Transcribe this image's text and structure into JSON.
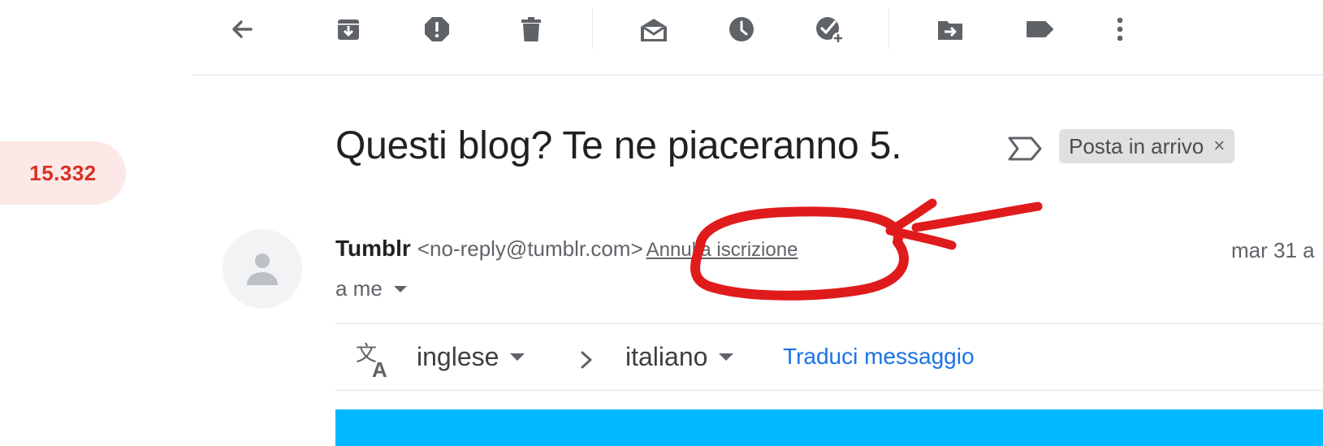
{
  "toolbar": {
    "buttons": [
      {
        "icon": "back-arrow-icon"
      },
      {
        "icon": "archive-icon"
      },
      {
        "icon": "report-spam-icon"
      },
      {
        "icon": "delete-icon"
      },
      {
        "icon": "mark-unread-icon"
      },
      {
        "icon": "snooze-icon"
      },
      {
        "icon": "add-to-tasks-icon"
      },
      {
        "icon": "move-to-icon"
      },
      {
        "icon": "label-icon"
      },
      {
        "icon": "more-vert-icon"
      }
    ]
  },
  "sidebar": {
    "inbox_count": "15.332"
  },
  "email": {
    "subject": "Questi blog? Te ne piaceranno 5.",
    "label_chip": "Posta in arrivo",
    "label_chip_close": "×",
    "sender_name": "Tumblr",
    "sender_email": "<no-reply@tumblr.com>",
    "unsubscribe": "Annulla iscrizione",
    "date": "mar 31 a",
    "recipient": "a me"
  },
  "translate": {
    "from_lang": "inglese",
    "to_lang": "italiano",
    "link": "Traduci messaggio"
  },
  "colors": {
    "accent_blue": "#1a73e8",
    "counter_red": "#d93025",
    "counter_bg": "#fce8e6",
    "annotation_red": "#e01b1b",
    "banner_blue": "#00b8ff",
    "icon_gray": "#5f6368"
  }
}
